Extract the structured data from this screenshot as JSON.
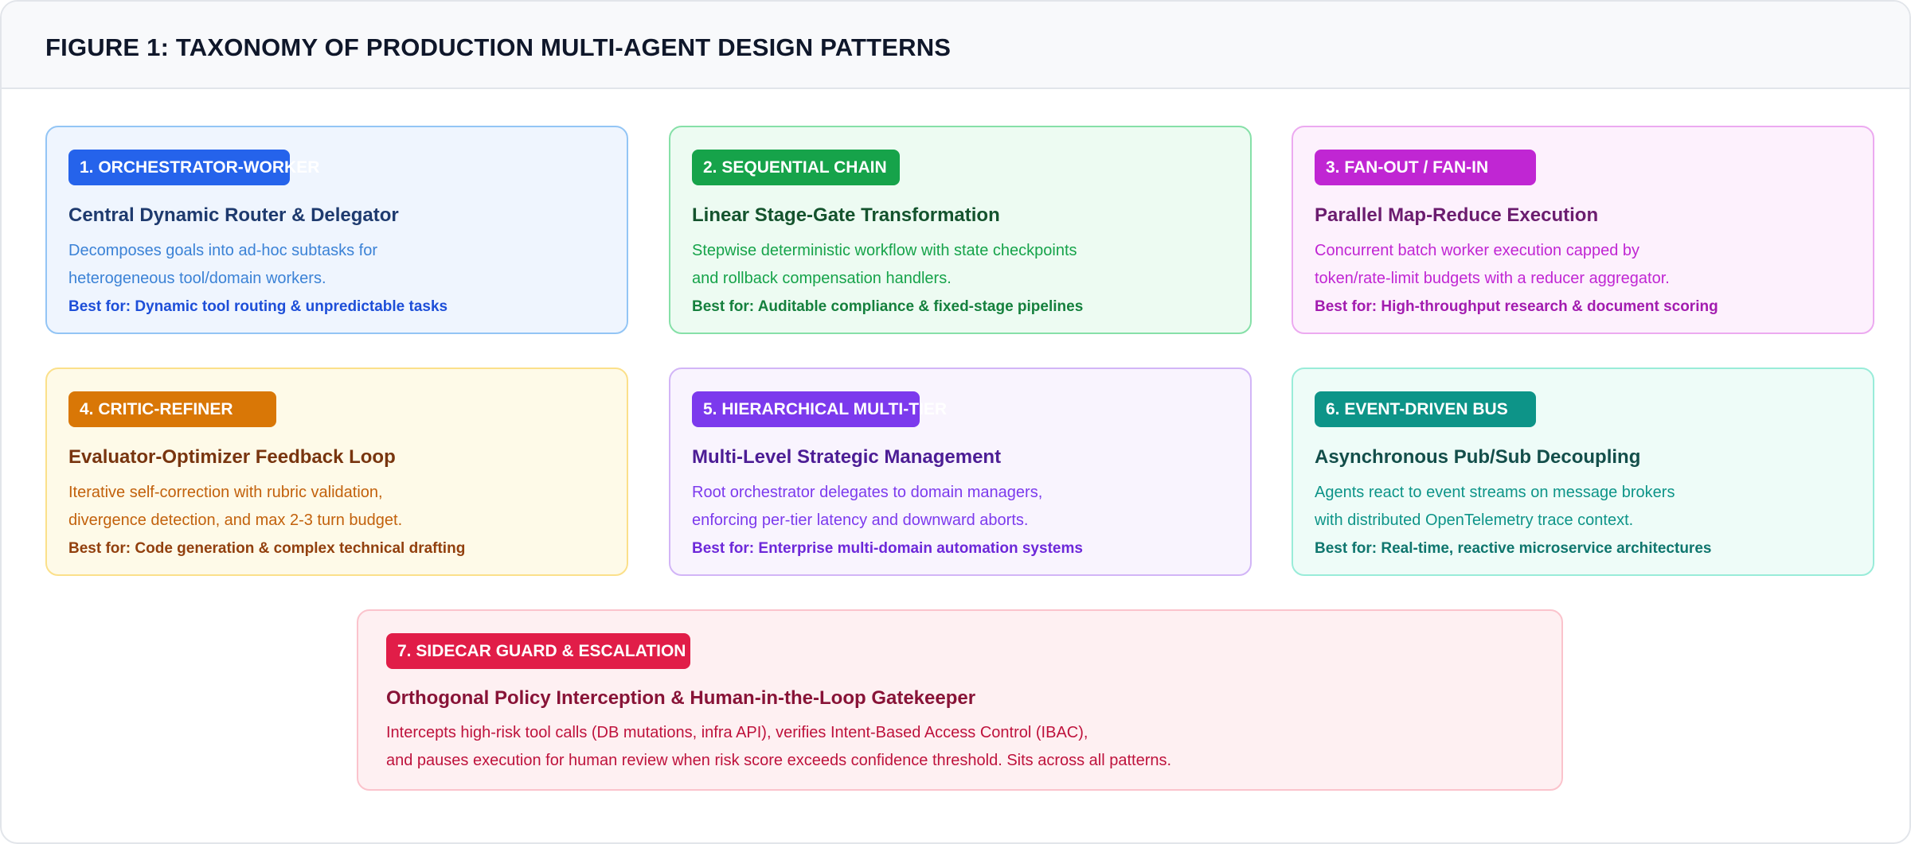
{
  "figure": {
    "title": "FIGURE 1: TAXONOMY OF PRODUCTION MULTI-AGENT DESIGN PATTERNS"
  },
  "colors": {
    "orchestrator_worker": "#2563eb",
    "sequential_chain": "#16a34a",
    "fan_out_fan_in": "#c026d3",
    "critic_refiner": "#d97706",
    "hierarchical_multi_tier": "#7c3aed",
    "event_driven_bus": "#0d9488",
    "sidecar_guard": "#e11d48"
  },
  "patterns": [
    {
      "badge": "1. ORCHESTRATOR-WORKER",
      "title": "Central Dynamic Router & Delegator",
      "desc_line1": "Decomposes goals into ad-hoc subtasks for",
      "desc_line2": "heterogeneous tool/domain workers.",
      "best_for": "Best for: Dynamic tool routing & unpredictable tasks"
    },
    {
      "badge": "2. SEQUENTIAL CHAIN",
      "title": "Linear Stage-Gate Transformation",
      "desc_line1": "Stepwise deterministic workflow with state checkpoints",
      "desc_line2": "and rollback compensation handlers.",
      "best_for": "Best for: Auditable compliance & fixed-stage pipelines"
    },
    {
      "badge": "3. FAN-OUT / FAN-IN",
      "title": "Parallel Map-Reduce Execution",
      "desc_line1": "Concurrent batch worker execution capped by",
      "desc_line2": "token/rate-limit budgets with a reducer aggregator.",
      "best_for": "Best for: High-throughput research & document scoring"
    },
    {
      "badge": "4. CRITIC-REFINER",
      "title": "Evaluator-Optimizer Feedback Loop",
      "desc_line1": "Iterative self-correction with rubric validation,",
      "desc_line2": "divergence detection, and max 2-3 turn budget.",
      "best_for": "Best for: Code generation & complex technical drafting"
    },
    {
      "badge": "5. HIERARCHICAL MULTI-TIER",
      "title": "Multi-Level Strategic Management",
      "desc_line1": "Root orchestrator delegates to domain managers,",
      "desc_line2": "enforcing per-tier latency and downward aborts.",
      "best_for": "Best for: Enterprise multi-domain automation systems"
    },
    {
      "badge": "6. EVENT-DRIVEN BUS",
      "title": "Asynchronous Pub/Sub Decoupling",
      "desc_line1": "Agents react to event streams on message brokers",
      "desc_line2": "with distributed OpenTelemetry trace context.",
      "best_for": "Best for: Real-time, reactive microservice architectures"
    },
    {
      "badge": "7. SIDECAR GUARD & ESCALATION",
      "title": "Orthogonal Policy Interception & Human-in-the-Loop Gatekeeper",
      "desc_line1": "Intercepts high-risk tool calls (DB mutations, infra API), verifies Intent-Based Access Control (IBAC),",
      "desc_line2": "and pauses execution for human review when risk score exceeds confidence threshold. Sits across all patterns."
    }
  ]
}
